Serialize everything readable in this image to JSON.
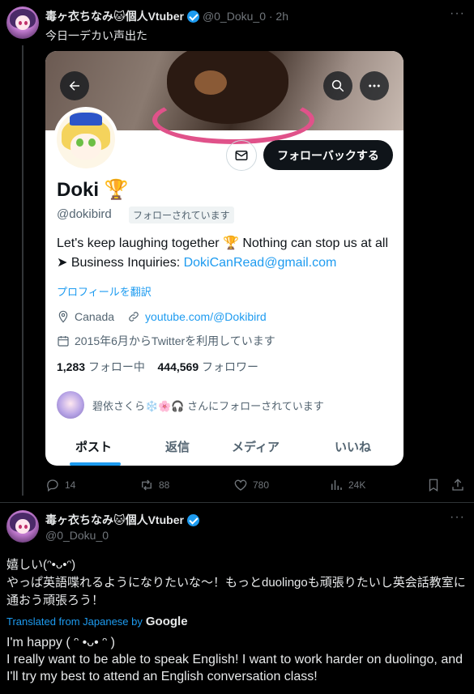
{
  "tweet1": {
    "author_name": "毒ヶ衣ちなみ🐱個人Vtuber",
    "handle_time": "@0_Doku_0 · 2h",
    "text": "今日一デカい声出た",
    "actions": {
      "reply": "14",
      "retweet": "88",
      "like": "780",
      "views": "24K"
    }
  },
  "card": {
    "name": "Doki 🏆",
    "handle": "@dokibird",
    "follows_you_badge": "フォローされています",
    "follow_back_label": "フォローバックする",
    "bio_plain": "Let's keep laughing together 🏆 Nothing can stop us at all ➤ Business Inquiries: ",
    "bio_link": "DokiCanRead@gmail.com",
    "translate_label": "プロフィールを翻訳",
    "location": "Canada",
    "website": "youtube.com/@Dokibird",
    "joined": "2015年6月からTwitterを利用しています",
    "following_count": "1,283",
    "following_label": "フォロー中",
    "followers_count": "444,569",
    "followers_label": "フォロワー",
    "followed_by": "碧依さくら❄️🌸🎧 さんにフォローされています",
    "tabs": [
      "ポスト",
      "返信",
      "メディア",
      "いいね"
    ]
  },
  "tweet2": {
    "author_name": "毒ヶ衣ちなみ🐱個人Vtuber",
    "handle": "@0_Doku_0",
    "text_line1": "嬉しい(ᵔ•ᴗ•ᵔ)",
    "text_line2": "やっぱ英語喋れるようになりたいな〜！もっとduolingoも頑張りたいし英会話教室に通おう頑張ろう！",
    "translated_from": "Translated from Japanese by",
    "translator": "Google",
    "translation_line1": "I'm happy ( ᵔ •ᴗ• ᵔ )",
    "translation_line2": "I really want to be able to speak English! I want to work harder on duolingo, and I'll try my best to attend an English conversation class!"
  },
  "icons": [
    "back-arrow-icon",
    "search-icon",
    "more-icon",
    "mail-icon",
    "location-icon",
    "link-icon",
    "calendar-icon",
    "reply-icon",
    "retweet-icon",
    "like-icon",
    "views-icon",
    "bookmark-icon",
    "share-icon",
    "verified-icon"
  ],
  "colors": {
    "accent": "#1d9bf0",
    "background": "#000000",
    "card": "#ffffff",
    "text": "#e7e9ea",
    "muted": "#71767b"
  }
}
